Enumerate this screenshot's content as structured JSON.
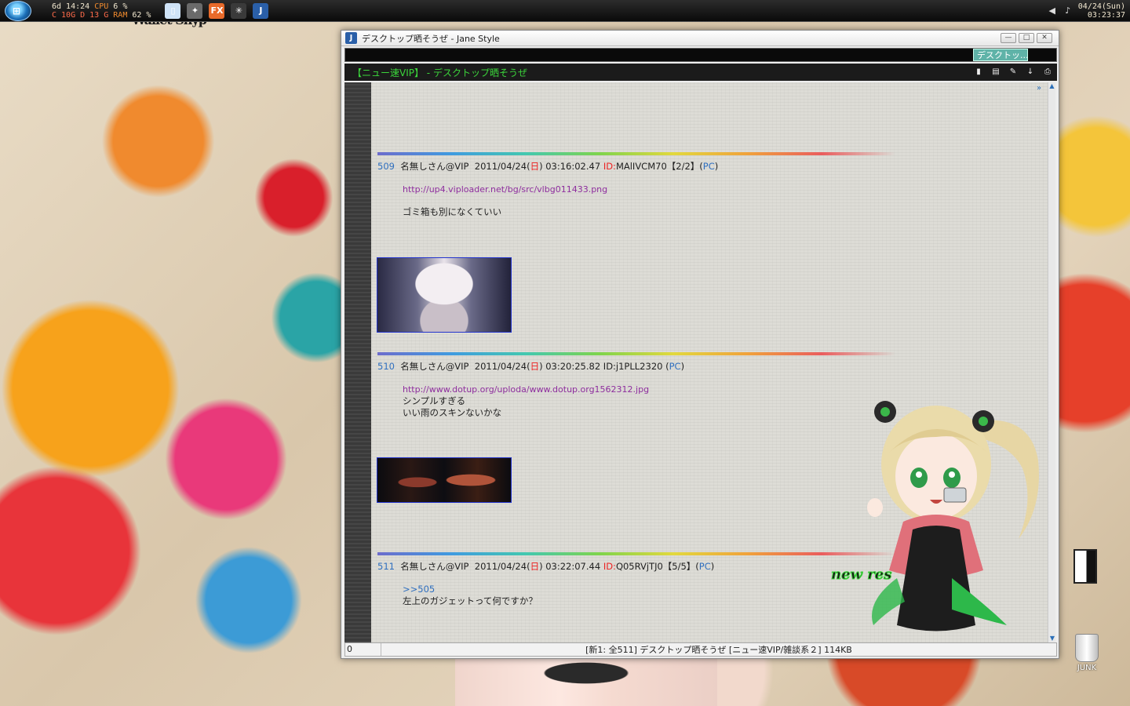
{
  "taskbar": {
    "start_label": "⊞",
    "sysmon": {
      "line1_left": "6d 14:24",
      "line1_cpu": "CPU",
      "line1_cpu_val": "6 %",
      "line2_left": "C 10G D 13 G",
      "line2_ram": "RAM",
      "line2_ram_val": "62 %"
    },
    "icons": [
      {
        "name": "notepad-icon",
        "glyph": "▯",
        "color": "#cfe3f7"
      },
      {
        "name": "tools-icon",
        "glyph": "✦",
        "color": "#6a6a6a"
      },
      {
        "name": "firefox-icon",
        "glyph": "FX",
        "color": "#e86a2a"
      },
      {
        "name": "sparkle-icon",
        "glyph": "✳",
        "color": "#3a3a3a"
      },
      {
        "name": "jane-icon",
        "glyph": "J",
        "color": "#2a5fa8"
      }
    ],
    "clock": {
      "date": "04/24(Sun)",
      "time": "03:23:37"
    }
  },
  "desktop_text": "Wallet Shyp",
  "window": {
    "title": "デスクトップ晒そうぜ - Jane Style",
    "app_icon": "J",
    "controls": {
      "minimize": "—",
      "maximize": "□",
      "close": "✕"
    },
    "active_tab": "デスクトッ...",
    "thread_title": "【ニュー速VIP】 - デスクトップ晒そうぜ",
    "posts": [
      {
        "num": "509",
        "name": "名無しさん@VIP",
        "date": "2011/04/24(",
        "dow": "日",
        "time": ") 03:16:02.47 ",
        "id_label": "ID:",
        "id": "MAlIVCM70【2/2】(",
        "pc": "PC",
        "close": ")",
        "link": "http://up4.viploader.net/bg/src/vlbg011433.png",
        "lines": [
          "ゴミ箱も別になくていい"
        ]
      },
      {
        "num": "510",
        "name": "名無しさん@VIP",
        "date": "2011/04/24(",
        "dow": "日",
        "time": ") 03:20:25.82 ID:j1PLL2320 (",
        "pc": "PC",
        "close": ")",
        "link": "http://www.dotup.org/uploda/www.dotup.org1562312.jpg",
        "lines": [
          "シンプルすぎる",
          "いい雨のスキンないかな"
        ]
      },
      {
        "num": "511",
        "name": "名無しさん@VIP",
        "date": "2011/04/24(",
        "dow": "日",
        "time": ") 03:22:07.44 ",
        "id_label": "ID:",
        "id": "Q05RVjTJ0【5/5】(",
        "pc": "PC",
        "close": ")",
        "anchor": ">>505",
        "lines": [
          "左上のガジェットって何ですか？"
        ]
      }
    ],
    "new_res": "new res",
    "status": {
      "count": "0",
      "info": "[新1: 全511] デスクトップ晒そうぜ [ニュー速VIP/雑談系２] 114KB"
    }
  },
  "trash_label": "JUNK"
}
